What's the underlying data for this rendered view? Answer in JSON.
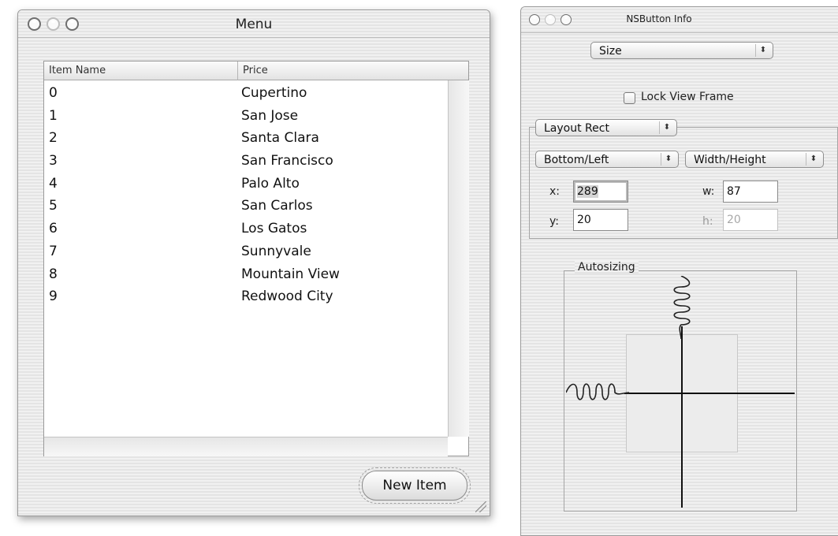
{
  "menu_window": {
    "title": "Menu",
    "table": {
      "columns": [
        "Item Name",
        "Price"
      ],
      "rows": [
        {
          "name": "0",
          "price": "Cupertino"
        },
        {
          "name": "1",
          "price": "San Jose"
        },
        {
          "name": "2",
          "price": "Santa Clara"
        },
        {
          "name": "3",
          "price": "San Francisco"
        },
        {
          "name": "4",
          "price": "Palo Alto"
        },
        {
          "name": "5",
          "price": "San Carlos"
        },
        {
          "name": "6",
          "price": "Los Gatos"
        },
        {
          "name": "7",
          "price": "Sunnyvale"
        },
        {
          "name": "8",
          "price": "Mountain View"
        },
        {
          "name": "9",
          "price": "Redwood City"
        }
      ]
    },
    "new_item_label": "New Item"
  },
  "info_window": {
    "title": "NSButton Info",
    "pane_popup": "Size",
    "lock_view_frame": "Lock View Frame",
    "rect_popup": "Layout Rect",
    "origin_popup": "Bottom/Left",
    "size_popup": "Width/Height",
    "x_label": "x:",
    "x_value": "289",
    "y_label": "y:",
    "y_value": "20",
    "w_label": "w:",
    "w_value": "87",
    "h_label": "h:",
    "h_value": "20",
    "autosizing_label": "Autosizing"
  },
  "icons": {
    "traffic_lights": [
      "close-button-icon",
      "minimize-button-icon",
      "zoom-button-icon"
    ],
    "popup_arrows": "up-down-arrows-icon",
    "spring": "spring-icon"
  },
  "colors": {
    "stripe_light": "#f1f1f1",
    "stripe_dark": "#e4e4e4",
    "border": "#9a9a9a"
  }
}
